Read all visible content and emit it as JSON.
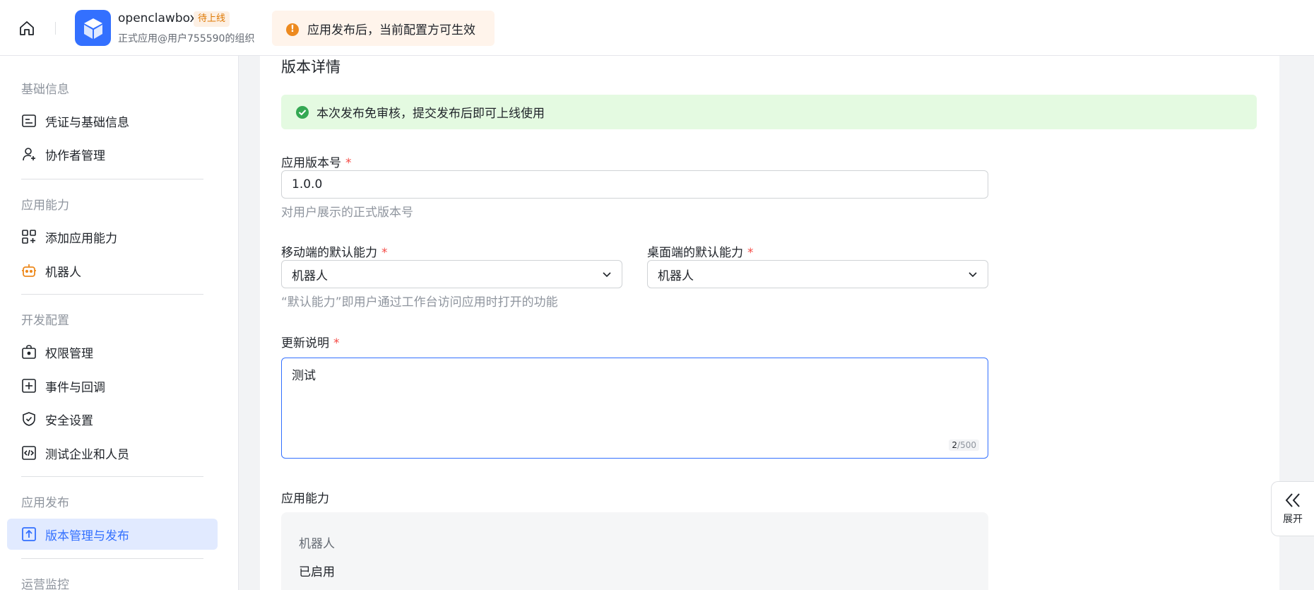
{
  "header": {
    "app_name": "openclawbox",
    "status_badge": "待上线",
    "org": "正式应用@用户755590的组织",
    "notice": "应用发布后，当前配置方可生效",
    "colors": {
      "accent": "#3370ff",
      "notice_bg": "#fff4eb",
      "notice_icon": "#ed8a1f"
    }
  },
  "sidebar": {
    "sections": [
      {
        "title": "基础信息"
      },
      {
        "title": "应用能力"
      },
      {
        "title": "开发配置"
      },
      {
        "title": "应用发布"
      },
      {
        "title": "运营监控"
      }
    ],
    "items": [
      {
        "label": "凭证与基础信息",
        "icon": "id-card-icon"
      },
      {
        "label": "协作者管理",
        "icon": "user-add-icon"
      },
      {
        "label": "添加应用能力",
        "icon": "apps-add-icon"
      },
      {
        "label": "机器人",
        "icon": "robot-icon"
      },
      {
        "label": "权限管理",
        "icon": "lock-box-icon"
      },
      {
        "label": "事件与回调",
        "icon": "event-icon"
      },
      {
        "label": "安全设置",
        "icon": "shield-check-icon"
      },
      {
        "label": "测试企业和人员",
        "icon": "code-icon"
      },
      {
        "label": "版本管理与发布",
        "icon": "upload-icon",
        "active": true
      }
    ]
  },
  "main": {
    "section_title": "版本详情",
    "success_banner": "本次发布免审核，提交发布后即可上线使用",
    "version": {
      "label": "应用版本号",
      "required_mark": "*",
      "value": "1.0.0",
      "hint": "对用户展示的正式版本号"
    },
    "mobile_default": {
      "label": "移动端的默认能力",
      "required_mark": "*",
      "value": "机器人"
    },
    "desktop_default": {
      "label": "桌面端的默认能力",
      "required_mark": "*",
      "value": "机器人"
    },
    "default_hint": "“默认能力”即用户通过工作台访问应用时打开的功能",
    "update_notes": {
      "label": "更新说明",
      "required_mark": "*",
      "value": "测试",
      "count": "2",
      "max": "/500"
    },
    "capabilities": {
      "label": "应用能力",
      "name": "机器人",
      "status": "已启用"
    }
  },
  "expand_button": {
    "label": "展开"
  }
}
